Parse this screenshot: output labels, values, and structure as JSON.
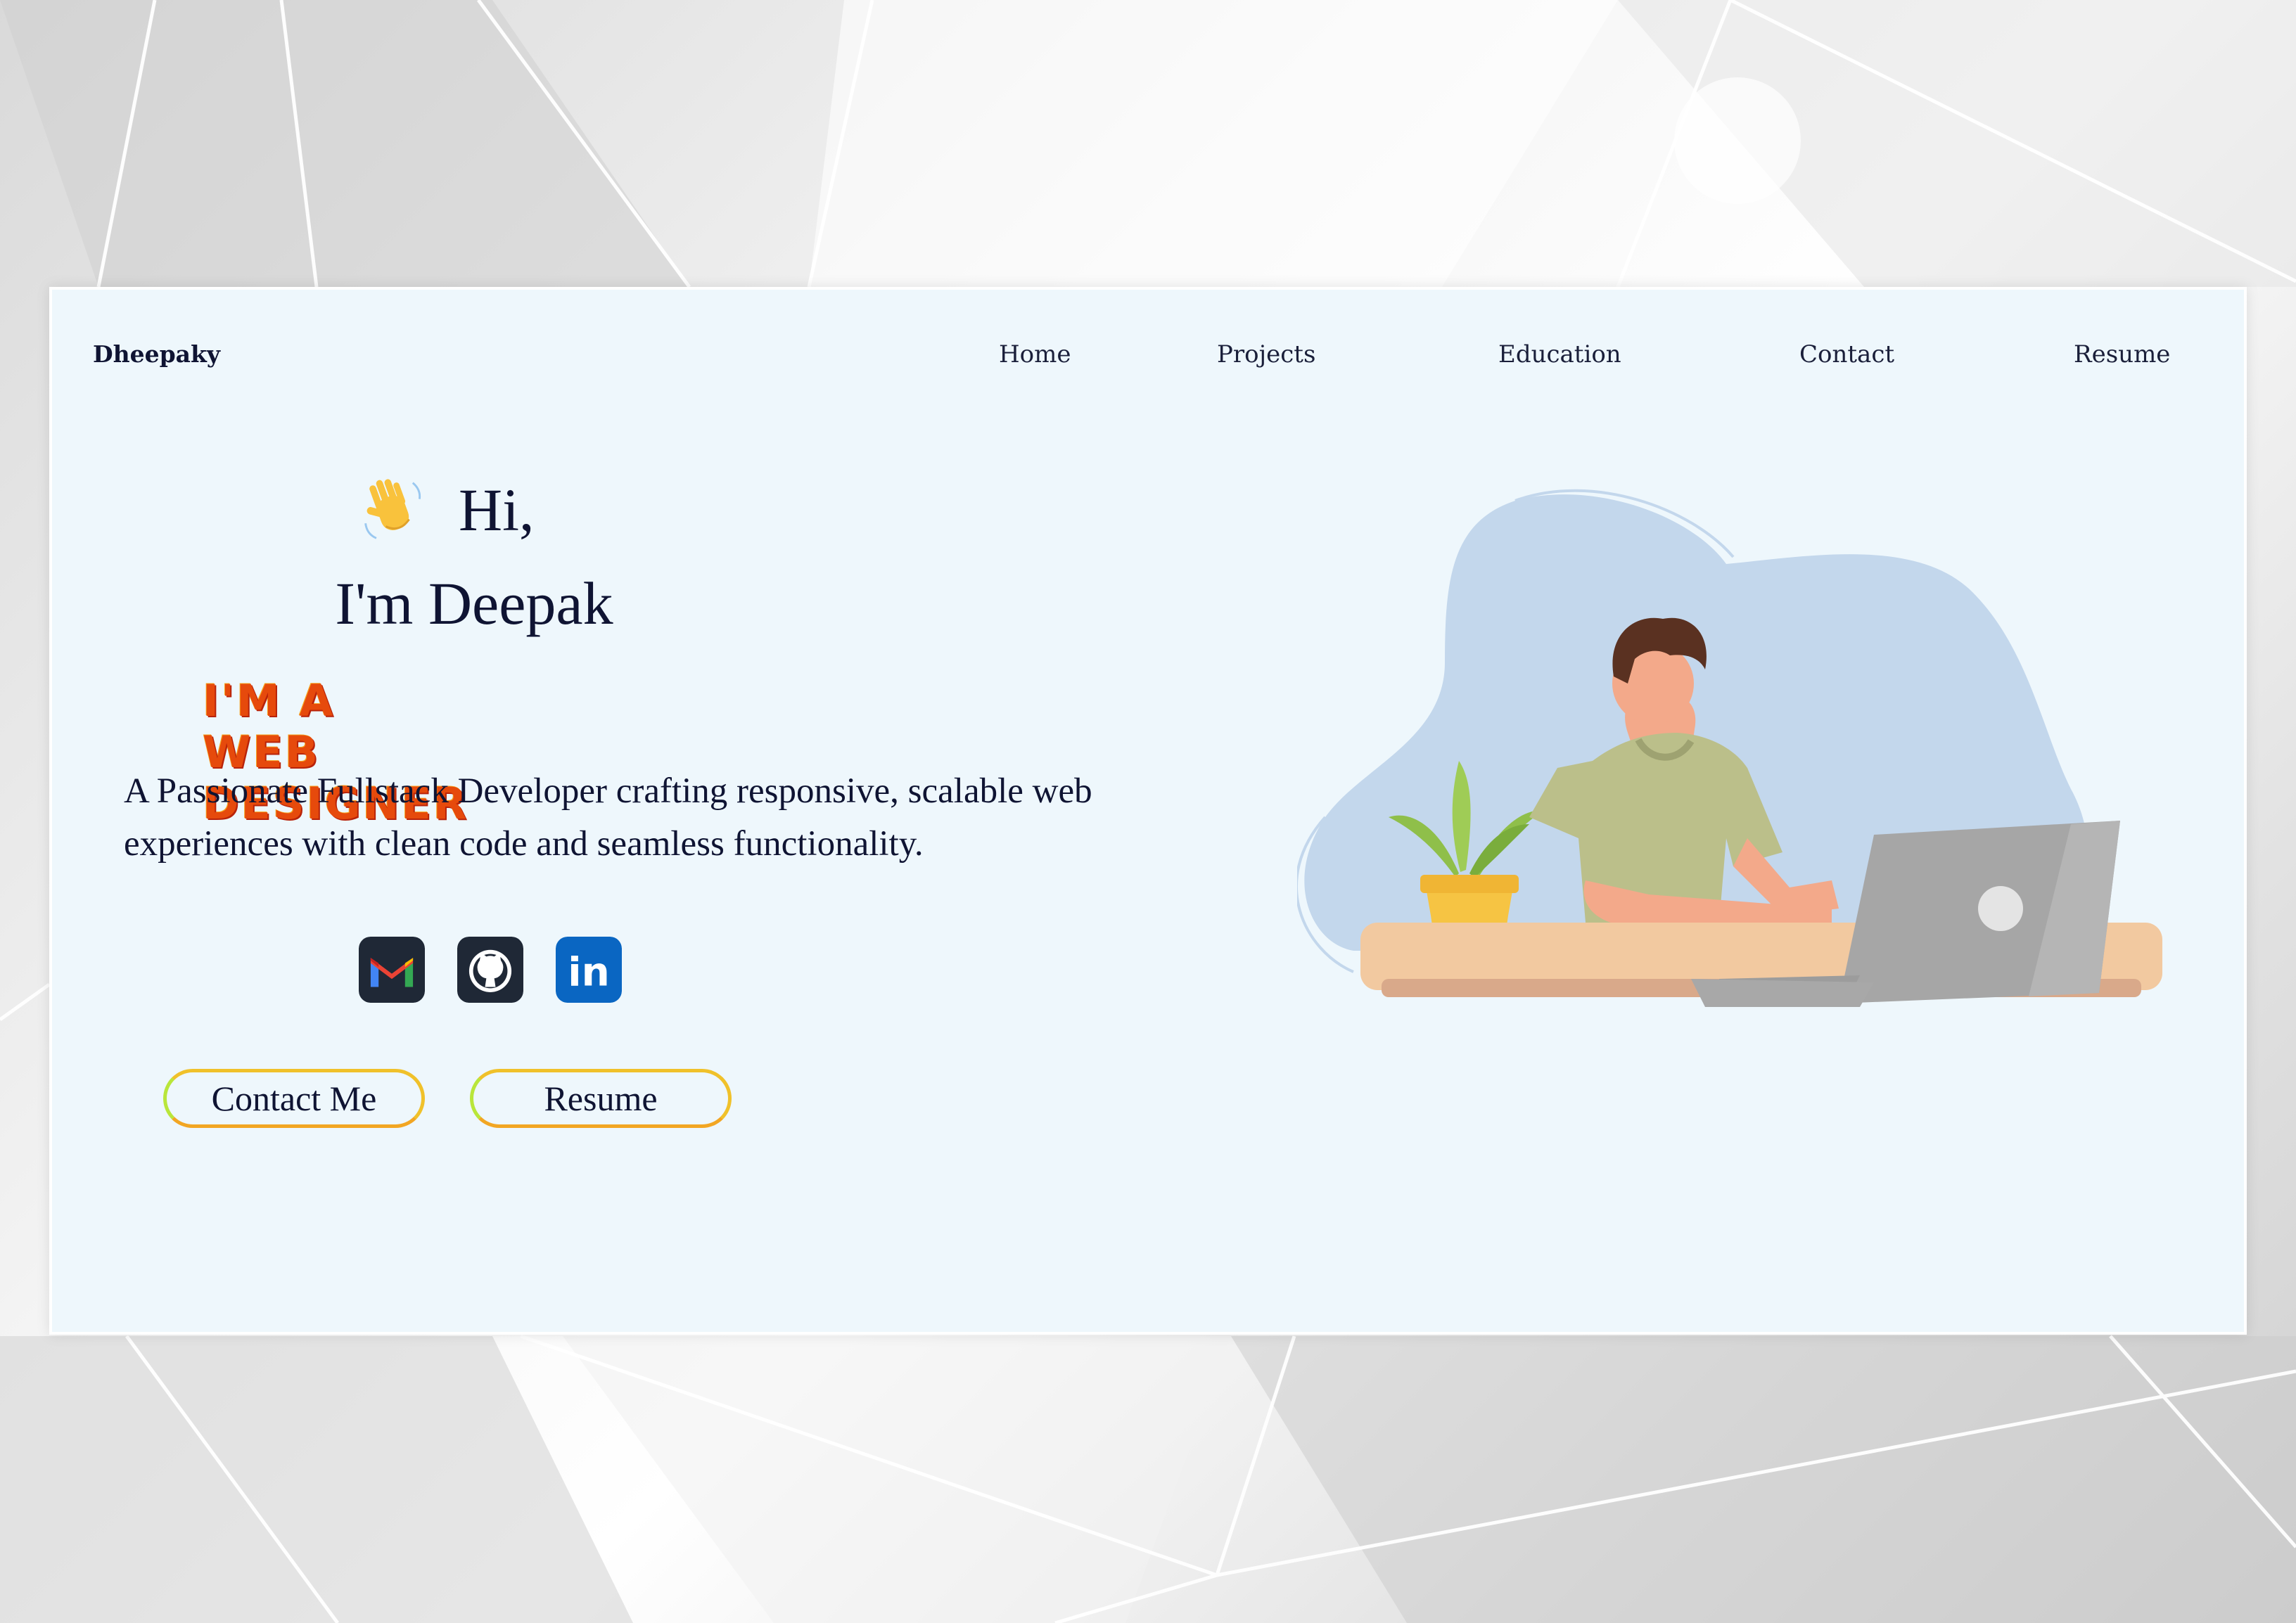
{
  "site": {
    "brand": "Dheepaky"
  },
  "nav": {
    "items": [
      "Home",
      "Projects",
      "Education",
      "Contact",
      "Resume"
    ]
  },
  "hero": {
    "greeting_icon": "waving-hand-icon",
    "greeting": "Hi,",
    "name": "I'm Deepak",
    "role": "I'M A WEB DESIGNER",
    "tagline": "A Passionate Fullstack Developer crafting responsive, scalable web experiences with clean code and seamless functionality."
  },
  "socials": [
    {
      "icon": "gmail-icon"
    },
    {
      "icon": "github-icon"
    },
    {
      "icon": "linkedin-icon",
      "text": "in"
    }
  ],
  "buttons": {
    "contact": "Contact Me",
    "resume": "Resume"
  },
  "illustration": {
    "icon": "developer-at-laptop-illustration"
  },
  "colors": {
    "page_background": "#eef7fc",
    "text": "#0f1433",
    "role_gradient_top": "#f7a21b",
    "role_gradient_bottom": "#d92d0f",
    "button_border": "#f0c12a",
    "linkedin": "#0a66c2"
  }
}
